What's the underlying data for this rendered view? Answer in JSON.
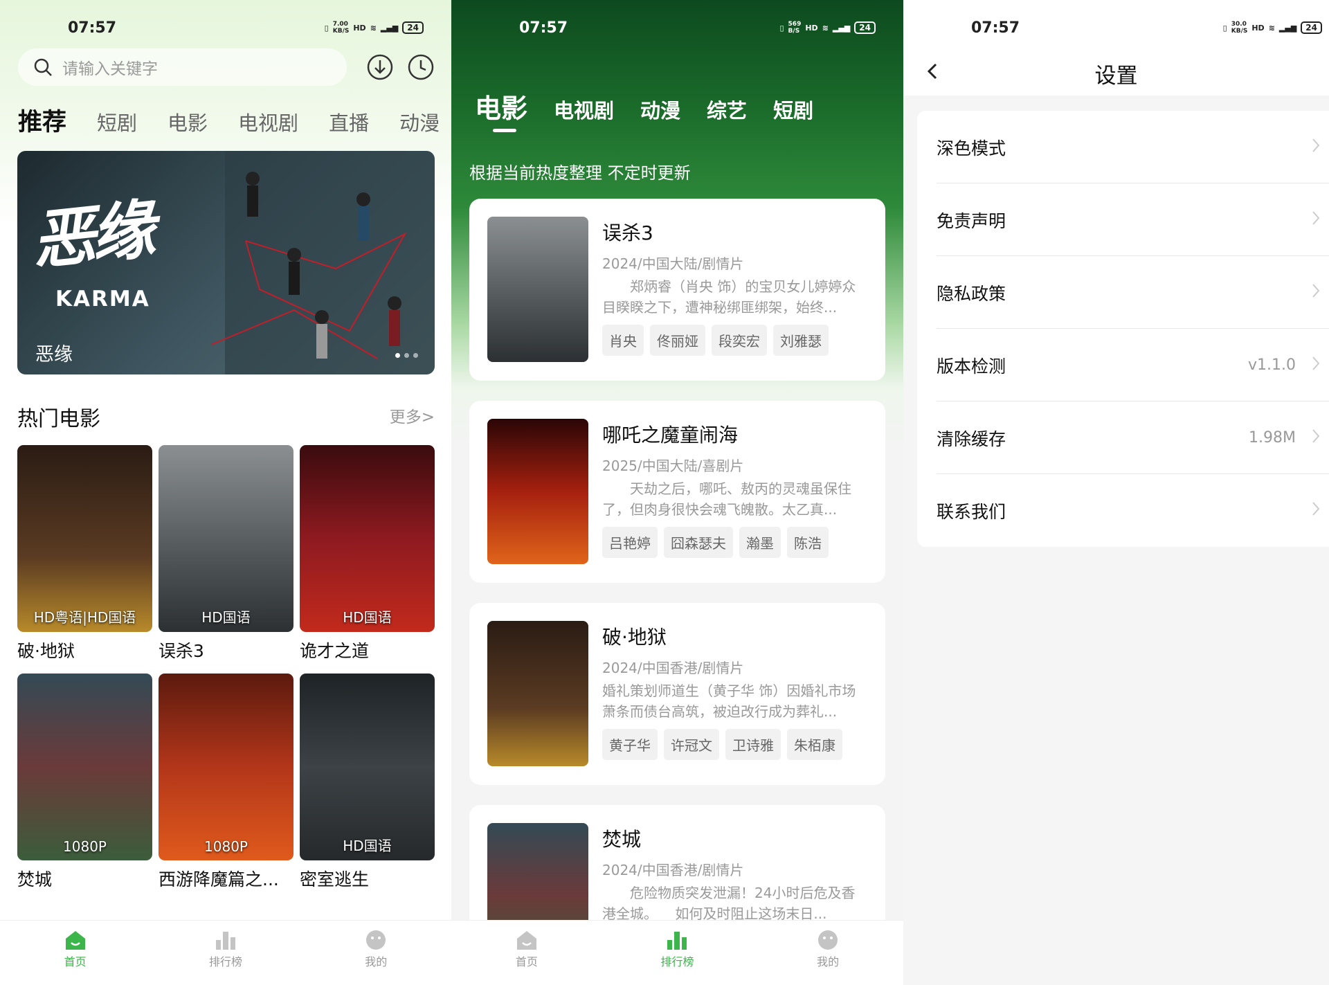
{
  "panel_home": {
    "status": {
      "time": "07:57",
      "net": "7.00\nKB/S",
      "battery": "24"
    },
    "search": {
      "placeholder": "请输入关键字"
    },
    "tabs": [
      "推荐",
      "短剧",
      "电影",
      "电视剧",
      "直播",
      "动漫"
    ],
    "banner": {
      "art_title": "恶缘",
      "art_subtitle": "KARMA",
      "caption": "恶缘"
    },
    "section": {
      "title": "热门电影",
      "more": "更多>"
    },
    "movies": [
      {
        "title": "破·地狱",
        "quality": "HD粤语|HD国语"
      },
      {
        "title": "误杀3",
        "quality": "HD国语"
      },
      {
        "title": "诡才之道",
        "quality": "HD国语"
      },
      {
        "title": "焚城",
        "quality": "1080P"
      },
      {
        "title": "西游降魔篇之...",
        "quality": "1080P"
      },
      {
        "title": "密室逃生",
        "quality": "HD国语"
      }
    ]
  },
  "panel_rank": {
    "status": {
      "time": "07:57",
      "net": "569\nB/S",
      "battery": "24"
    },
    "tabs": [
      "电影",
      "电视剧",
      "动漫",
      "综艺",
      "短剧"
    ],
    "hint": "根据当前热度整理 不定时更新",
    "cards": [
      {
        "title": "误杀3",
        "meta": "2024/中国大陆/剧情片",
        "desc": "郑炳睿（肖央 饰）的宝贝女儿婷婷众目睽睽之下，遭神秘绑匪绑架，始终...",
        "cast": [
          "肖央",
          "佟丽娅",
          "段奕宏",
          "刘雅瑟"
        ]
      },
      {
        "title": "哪吒之魔童闹海",
        "meta": "2025/中国大陆/喜剧片",
        "desc": "天劫之后，哪吒、敖丙的灵魂虽保住了，但肉身很快会魂飞魄散。太乙真...",
        "cast": [
          "吕艳婷",
          "囧森瑟夫",
          "瀚墨",
          "陈浩"
        ]
      },
      {
        "title": "破·地狱",
        "meta": "2024/中国香港/剧情片",
        "desc": "婚礼策划师道生（黄子华 饰）因婚礼市场萧条而债台高筑，被迫改行成为葬礼...",
        "cast": [
          "黄子华",
          "许冠文",
          "卫诗雅",
          "朱栢康"
        ]
      },
      {
        "title": "焚城",
        "meta": "2024/中国香港/剧情片",
        "desc": "危险物质突发泄漏！24小时后危及香港全城。    如何及时阻止这场末日...",
        "cast": []
      }
    ]
  },
  "panel_settings": {
    "status": {
      "time": "07:57",
      "net": "30.0\nKB/S",
      "battery": "24"
    },
    "title": "设置",
    "rows": [
      {
        "label": "深色模式",
        "value": ""
      },
      {
        "label": "免责声明",
        "value": ""
      },
      {
        "label": "隐私政策",
        "value": ""
      },
      {
        "label": "版本检测",
        "value": "v1.1.0"
      },
      {
        "label": "清除缓存",
        "value": "1.98M"
      },
      {
        "label": "联系我们",
        "value": ""
      }
    ]
  },
  "tabbar": [
    "首页",
    "排行榜",
    "我的"
  ],
  "colors": {
    "accent": "#3cb54a",
    "inactive": "#c4c4c4"
  }
}
